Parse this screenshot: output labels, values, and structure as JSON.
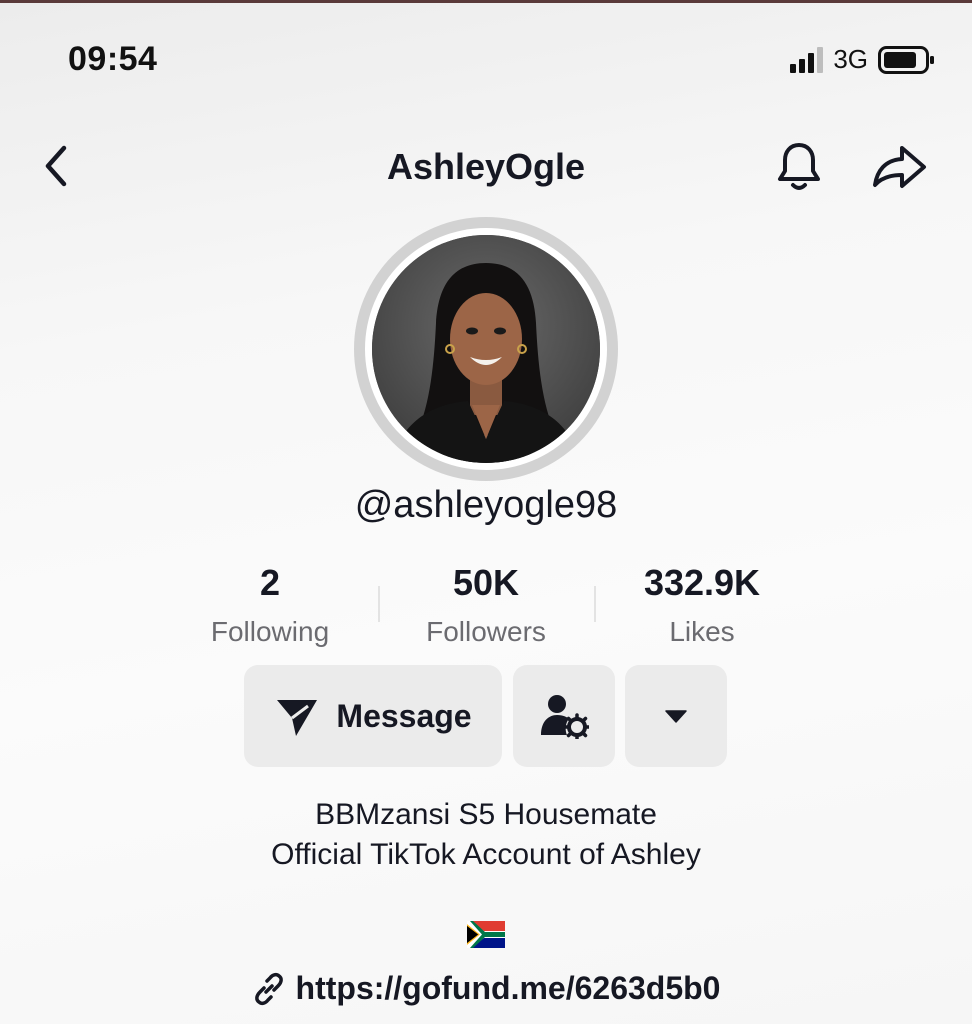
{
  "status_bar": {
    "time": "09:54",
    "network": "3G",
    "signal_icon": "signal-bars-icon",
    "battery_icon": "battery-icon"
  },
  "nav": {
    "back_icon": "chevron-left-icon",
    "title": "AshleyOgle",
    "bell_icon": "bell-icon",
    "share_icon": "share-arrow-icon"
  },
  "profile": {
    "avatar": "profile-photo",
    "handle": "@ashleyogle98"
  },
  "stats": [
    {
      "value": "2",
      "label": "Following"
    },
    {
      "value": "50K",
      "label": "Followers"
    },
    {
      "value": "332.9K",
      "label": "Likes"
    }
  ],
  "actions": {
    "message_label": "Message",
    "message_icon": "send-icon",
    "friend_icon": "user-settings-icon",
    "more_icon": "caret-down-icon"
  },
  "bio": {
    "line1": "BBMzansi S5 Housemate",
    "line2": "Official TikTok Account of Ashley",
    "flag": "south-africa-flag",
    "link_icon": "link-icon",
    "link": "https://gofund.me/6263d5b0"
  },
  "colors": {
    "text": "#161823",
    "muted": "#6b6b70",
    "button_bg": "#ebebeb"
  }
}
